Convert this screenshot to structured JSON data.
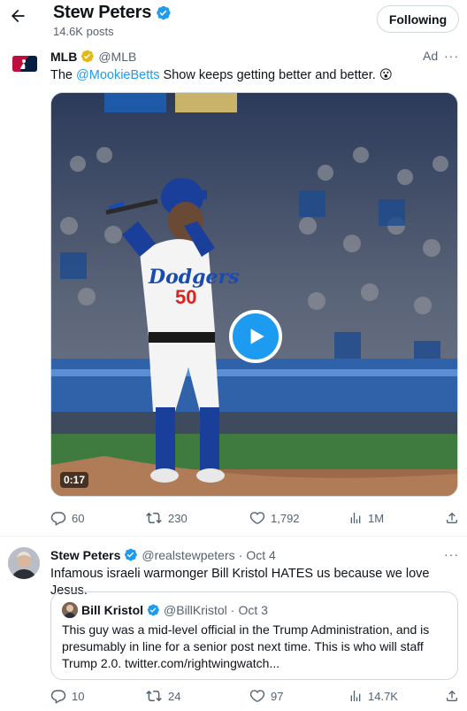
{
  "header": {
    "title": "Stew Peters",
    "post_count": "14.6K posts",
    "following_label": "Following"
  },
  "tweet1": {
    "name": "MLB",
    "handle": "@MLB",
    "ad_label": "Ad",
    "more": "···",
    "text_before": "The ",
    "mention": "@MookieBetts",
    "text_after": " Show keeps getting better and better. 😮",
    "video_duration": "0:17",
    "jersey_number": "50",
    "replies": "60",
    "reposts": "230",
    "likes": "1,792",
    "views": "1M"
  },
  "tweet2": {
    "name": "Stew Peters",
    "handle": "@realstewpeters",
    "dot": "·",
    "date": "Oct 4",
    "more": "···",
    "text": "Infamous israeli warmonger Bill Kristol HATES us because we love Jesus.",
    "quote": {
      "name": "Bill Kristol",
      "handle": "@BillKristol",
      "dot": "·",
      "date": "Oct 3",
      "text": "This guy was a mid-level official in the Trump Administration, and is presumably in line for a senior post next time. This is who will staff Trump 2.0. twitter.com/rightwingwatch..."
    },
    "replies": "10",
    "reposts": "24",
    "likes": "97",
    "views": "14.7K"
  },
  "colors": {
    "accent": "#1d9bf0",
    "secondary_text": "#536471",
    "border": "#cfd9de",
    "verified_blue": "#1d9bf0",
    "verified_gold": "#e2b719"
  }
}
